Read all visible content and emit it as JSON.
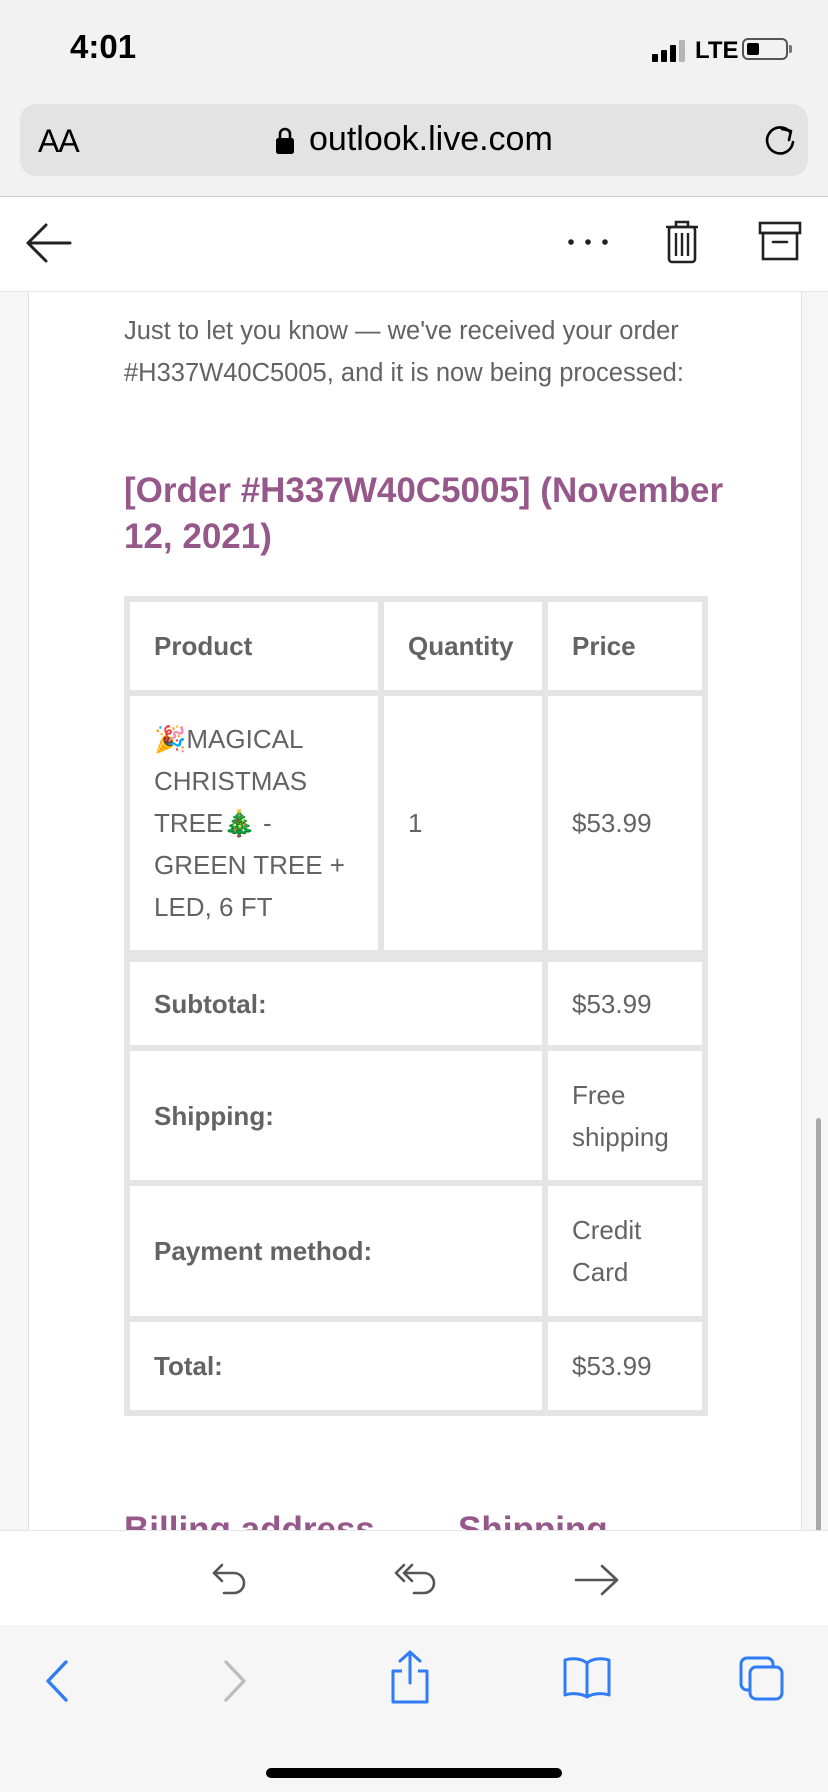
{
  "status_bar": {
    "time": "4:01",
    "network": "LTE",
    "icons": [
      "cellular-signal-icon",
      "battery-icon"
    ]
  },
  "browser": {
    "text_size_button": "AA",
    "url": "outlook.live.com",
    "icons": [
      "lock-icon",
      "reload-icon"
    ]
  },
  "mail_toolbar": {
    "icons": [
      "back-arrow-icon",
      "more-options-icon",
      "trash-icon",
      "archive-icon"
    ]
  },
  "email": {
    "intro": "Just to let you know — we've received your order #H337W40C5005, and it is now being processed:",
    "order_heading": "[Order #H337W40C5005] (November 12, 2021)",
    "heading_color": "#96588a",
    "table": {
      "headers": [
        "Product",
        "Quantity",
        "Price"
      ],
      "items": [
        {
          "product": "🎉MAGICAL CHRISTMAS TREE🎄 - GREEN TREE + LED, 6 FT",
          "quantity": "1",
          "price": "$53.99"
        }
      ],
      "totals": [
        {
          "label": "Subtotal:",
          "value": "$53.99"
        },
        {
          "label": "Shipping:",
          "value": "Free shipping"
        },
        {
          "label": "Payment method:",
          "value": "Credit Card"
        },
        {
          "label": "Total:",
          "value": "$53.99"
        }
      ]
    },
    "billing_heading": "Billing address",
    "shipping_heading": "Shipping"
  },
  "reply_bar": {
    "icons": [
      "reply-icon",
      "reply-all-icon",
      "forward-icon"
    ]
  },
  "safari_toolbar": {
    "icons": [
      "back-icon",
      "forward-icon",
      "share-icon",
      "bookmarks-icon",
      "tabs-icon"
    ],
    "accent_color": "#2f7cf6"
  }
}
